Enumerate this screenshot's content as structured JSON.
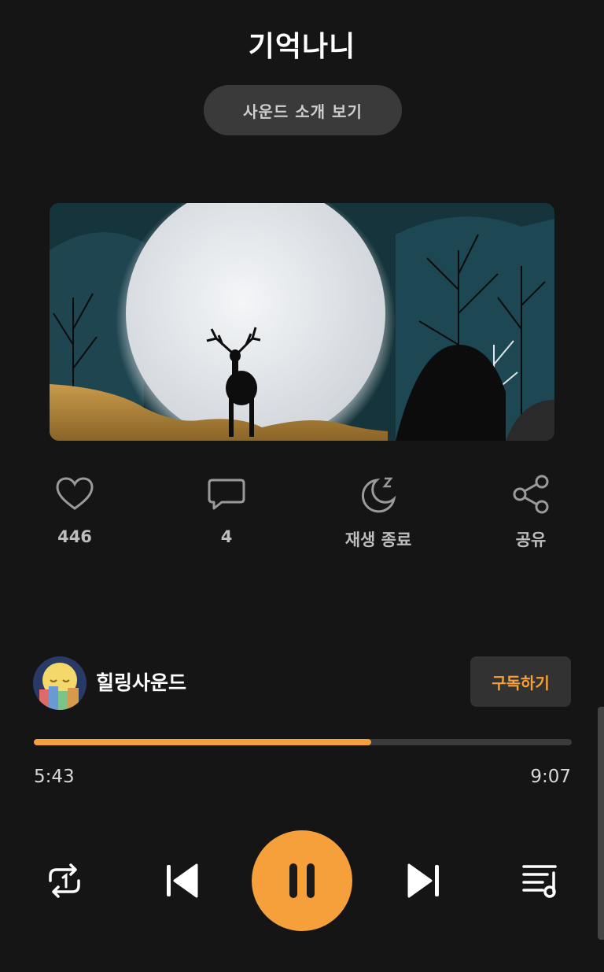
{
  "header": {
    "title": "기억나니",
    "intro_button": "사운드 소개 보기"
  },
  "actions": {
    "like_count": "446",
    "comment_count": "4",
    "sleep_timer_label": "재생 종료",
    "share_label": "공유"
  },
  "channel": {
    "name": "힐링사운드",
    "subscribe_label": "구독하기"
  },
  "player": {
    "current_time": "5:43",
    "duration": "9:07",
    "progress_fraction": 0.627
  },
  "icons": [
    "heart-icon",
    "comment-icon",
    "moon-sleep-icon",
    "share-icon",
    "repeat-one-icon",
    "previous-icon",
    "pause-icon",
    "next-icon",
    "playlist-icon"
  ],
  "colors": {
    "accent": "#f5a03a",
    "background": "#151515",
    "button_bg": "#3a3a3a"
  }
}
